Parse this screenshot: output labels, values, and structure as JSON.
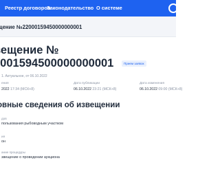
{
  "header": {
    "nav": [
      "Реестр договоров",
      "Законодательство",
      "О системе"
    ]
  },
  "breadcrumb": "щение №22000159450000000001",
  "title": {
    "line1": "вещение №",
    "line2": "0001594500000000001"
  },
  "status_badge": "Прием заявок",
  "sub_status": "1. Актуальное, от 06.10.2022",
  "dates": [
    {
      "label": "ения",
      "value": "2022",
      "tz": "17:34 (МСК+8)"
    },
    {
      "label": "Дата публикации",
      "value": "06.10.2022",
      "tz": "23:21 (МСК+8)"
    },
    {
      "label": "Дата изменения",
      "value": "06.10.2022",
      "tz": "09:00 (МСК+8)"
    }
  ],
  "section_title": "овные сведения об извещении",
  "fields": [
    {
      "label": "дов",
      "value": "пользования рыбоводным участком"
    },
    {
      "label": "ия",
      "value": "он"
    },
    {
      "label": "ание процедуры",
      "value": "звещение о проведении аукциона"
    }
  ]
}
